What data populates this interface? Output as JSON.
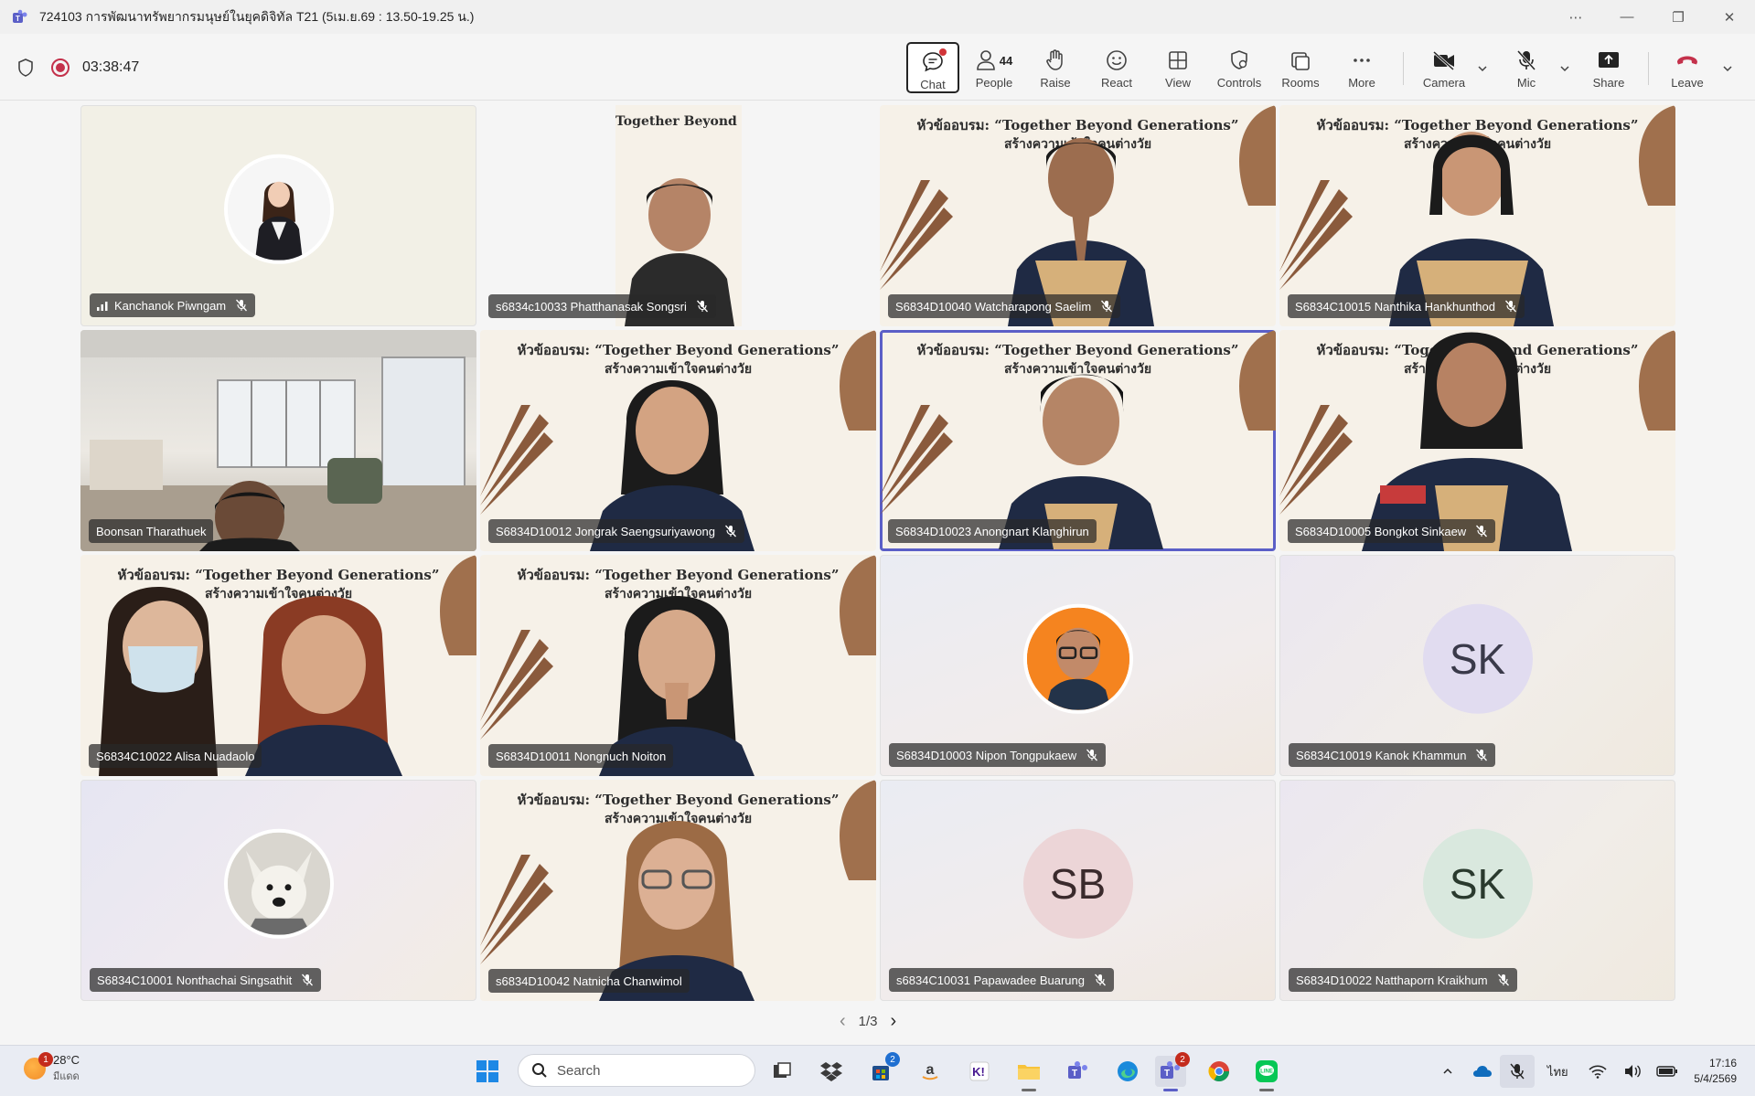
{
  "window": {
    "title": "724103 การพัฒนาทรัพยากรมนุษย์ในยุคดิจิทัล T21 (5เม.ย.69 : 13.50-19.25 น.)"
  },
  "meeting": {
    "timer": "03:38:47"
  },
  "toolbar": {
    "chat": "Chat",
    "people": "People",
    "people_count": "44",
    "raise": "Raise",
    "react": "React",
    "view": "View",
    "controls": "Controls",
    "rooms": "Rooms",
    "more": "More",
    "camera": "Camera",
    "mic": "Mic",
    "share": "Share",
    "leave": "Leave"
  },
  "banner": {
    "line1": "หัวข้ออบรม: “Together Beyond Generations”",
    "line2": "สร้างความเข้าใจคนต่างวัย"
  },
  "participants": [
    {
      "name": "Kanchanok Piwngam",
      "muted": true,
      "speaking_indicator": true
    },
    {
      "name": "s6834c10033 Phatthanasak Songsri",
      "muted": true
    },
    {
      "name": "S6834D10040 Watcharapong Saelim",
      "muted": true
    },
    {
      "name": "S6834C10015 Nanthika Hankhunthod",
      "muted": true
    },
    {
      "name": "Boonsan Tharathuek",
      "muted": false
    },
    {
      "name": "S6834D10012 Jongrak Saengsuriyawong",
      "muted": true
    },
    {
      "name": "S6834D10023 Anongnart Klanghirun",
      "muted": false,
      "active_speaker": true
    },
    {
      "name": "S6834D10005 Bongkot Sinkaew",
      "muted": true
    },
    {
      "name": "S6834C10022 Alisa Nuadaolo",
      "muted": false
    },
    {
      "name": "S6834D10011 Nongnuch Noiton",
      "muted": false
    },
    {
      "name": "S6834D10003 Nipon Tongpukaew",
      "muted": true
    },
    {
      "name": "S6834C10019 Kanok Khammun",
      "muted": true,
      "initials": "SK"
    },
    {
      "name": "S6834C10001 Nonthachai Singsathit",
      "muted": true
    },
    {
      "name": "s6834D10042 Natnicha Chanwimol",
      "muted": false
    },
    {
      "name": "s6834C10031 Papawadee Buarung",
      "muted": true,
      "initials": "SB"
    },
    {
      "name": "S6834D10022 Natthaporn Kraikhum",
      "muted": true,
      "initials": "SK"
    }
  ],
  "pager": {
    "label": "1/3"
  },
  "taskbar": {
    "weather_temp": "28°C",
    "weather_cond": "มีแดด",
    "weather_badge": "1",
    "search_placeholder": "Search",
    "store_badge": "2",
    "teams_badge": "2",
    "language": "ไทย",
    "time": "17:16",
    "date": "5/4/2569"
  },
  "colors": {
    "accent": "#5b5fc7",
    "leave": "#c4314b",
    "record": "#c4314b"
  }
}
